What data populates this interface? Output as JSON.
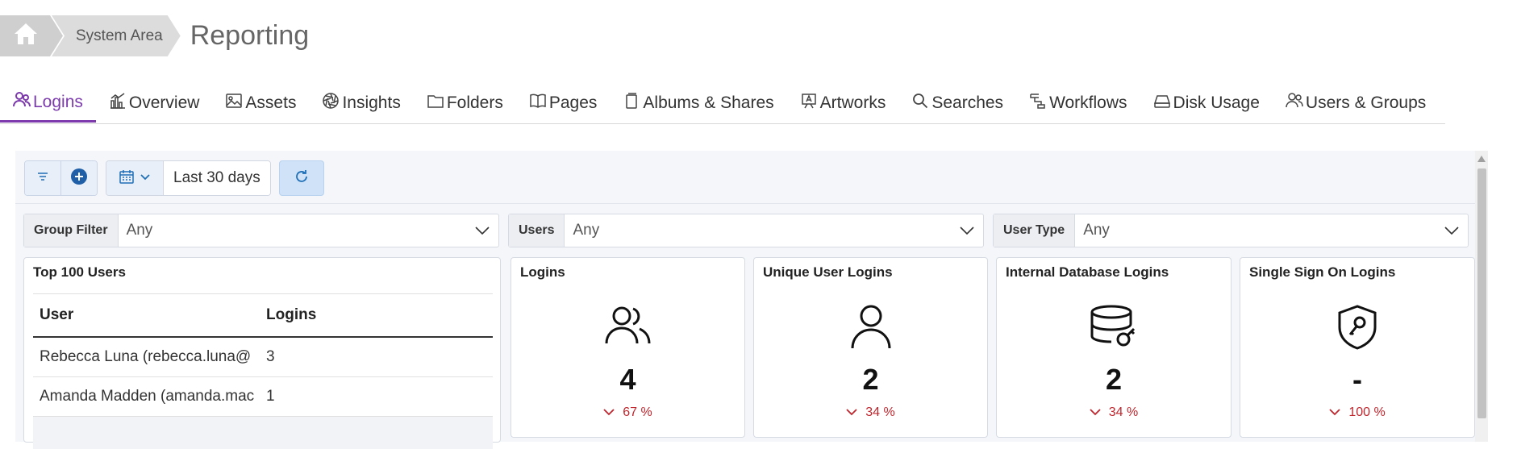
{
  "breadcrumb": {
    "section": "System Area",
    "title": "Reporting"
  },
  "tabs": [
    {
      "label": "Logins",
      "icon": "users-icon",
      "active": true
    },
    {
      "label": "Overview",
      "icon": "bar-chart-icon"
    },
    {
      "label": "Assets",
      "icon": "image-icon"
    },
    {
      "label": "Insights",
      "icon": "aperture-icon"
    },
    {
      "label": "Folders",
      "icon": "folder-icon"
    },
    {
      "label": "Pages",
      "icon": "book-icon"
    },
    {
      "label": "Albums & Shares",
      "icon": "album-icon"
    },
    {
      "label": "Artworks",
      "icon": "easel-icon"
    },
    {
      "label": "Searches",
      "icon": "search-icon"
    },
    {
      "label": "Workflows",
      "icon": "workflow-icon"
    },
    {
      "label": "Disk Usage",
      "icon": "disk-icon"
    },
    {
      "label": "Users & Groups",
      "icon": "users-group-icon"
    }
  ],
  "toolbar": {
    "date_range": "Last 30 days"
  },
  "filters": [
    {
      "label": "Group Filter",
      "value": "Any"
    },
    {
      "label": "Users",
      "value": "Any"
    },
    {
      "label": "User Type",
      "value": "Any"
    }
  ],
  "top_users": {
    "title": "Top 100 Users",
    "columns": [
      "User",
      "Logins"
    ],
    "rows": [
      {
        "user": "Rebecca Luna (rebecca.luna@",
        "logins": "3"
      },
      {
        "user": "Amanda Madden (amanda.mac",
        "logins": "1"
      }
    ]
  },
  "kpis": [
    {
      "title": "Logins",
      "value": "4",
      "change": "67 %",
      "icon": "users-icon"
    },
    {
      "title": "Unique User Logins",
      "value": "2",
      "change": "34 %",
      "icon": "user-icon"
    },
    {
      "title": "Internal Database Logins",
      "value": "2",
      "change": "34 %",
      "icon": "database-key-icon"
    },
    {
      "title": "Single Sign On Logins",
      "value": "-",
      "change": "100 %",
      "icon": "shield-key-icon"
    }
  ],
  "colors": {
    "accent": "#7c3aad",
    "negative": "#c0262d",
    "primary_blue": "#1f6fb8"
  }
}
